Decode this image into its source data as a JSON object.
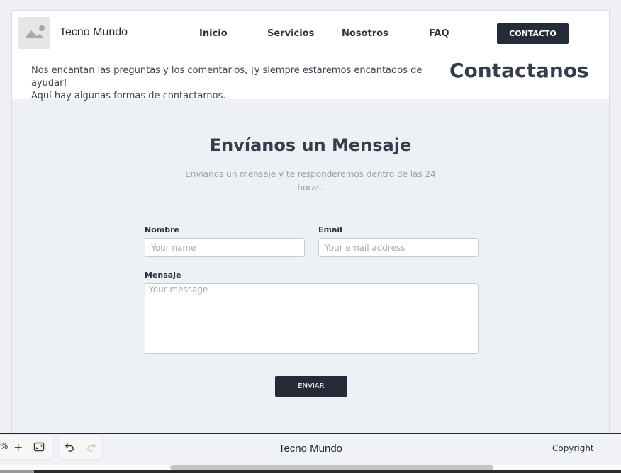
{
  "header": {
    "brand": "Tecno Mundo",
    "logo_icon": "image-placeholder-icon",
    "nav": [
      "Inicio",
      "Servicios",
      "Nosotros",
      "FAQ"
    ],
    "cta": "CONTACTO"
  },
  "hero": {
    "intro_line1": "Nos encantan las preguntas y los comentarios, ¡y siempre estaremos encantados de ayudar!",
    "intro_line2": "Aquí hay algunas formas de contactarnos.",
    "title": "Contactanos"
  },
  "form": {
    "heading": "Envíanos un Mensaje",
    "subheading": "Envíanos un mensaje y te responderemos dentro de las 24 horas.",
    "name_label": "Nombre",
    "name_placeholder": "Your name",
    "email_label": "Email",
    "email_placeholder": "Your email address",
    "message_label": "Mensaje",
    "message_placeholder": "Your message",
    "submit": "ENVIAR"
  },
  "footer": {
    "brand": "Tecno Mundo",
    "copyright": "Copyright"
  },
  "editor_toolbar": {
    "zoom_suffix": "%",
    "zoom_in": "+",
    "icons": [
      "zoom-in-icon",
      "fit-screen-icon",
      "undo-icon",
      "redo-icon"
    ]
  },
  "colors": {
    "dark": "#252c37",
    "background": "#edf0f4",
    "header_bg": "#ffffff"
  }
}
